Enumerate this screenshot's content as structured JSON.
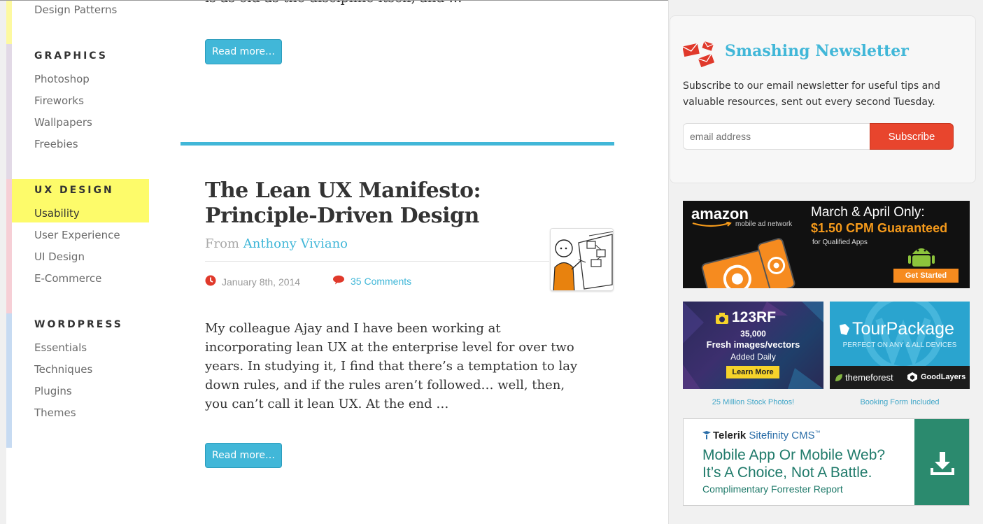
{
  "nav": {
    "top_item": "Design Patterns",
    "sections": [
      {
        "heading": "GRAPHICS",
        "items": [
          "Photoshop",
          "Fireworks",
          "Wallpapers",
          "Freebies"
        ]
      },
      {
        "heading": "UX DESIGN",
        "items": [
          "Usability",
          "User Experience",
          "UI Design",
          "E-Commerce"
        ]
      },
      {
        "heading": "WORDPRESS",
        "items": [
          "Essentials",
          "Techniques",
          "Plugins",
          "Themes"
        ]
      }
    ],
    "strip_colors": [
      "#fdf9a0",
      "#e2d9e6",
      "#f6cfd6",
      "#c7dbf2"
    ],
    "highlight_color": "#fdfb6a"
  },
  "prev_post": {
    "excerpt_tail": "is as old as the discipline itself, and …",
    "read_more": "Read more…"
  },
  "post": {
    "title_line1": "The Lean UX Manifesto:",
    "title_line2": "Principle-Driven Design",
    "from_label": "From",
    "author": "Anthony Viviano",
    "date": "January 8th, 2014",
    "comments": "35 Comments",
    "excerpt": "My colleague Ajay and I have been working at incorporating lean UX at the enterprise level for over two years. In studying it, I find that there’s a temptation to lay down rules, and if the rules aren’t followed… well, then, you can’t call it lean UX. At the end …",
    "read_more": "Read more…"
  },
  "newsletter": {
    "title": "Smashing Newsletter",
    "text": "Subscribe to our email newsletter for useful tips and valuable resources, sent out every second Tuesday.",
    "placeholder": "email address",
    "button": "Subscribe"
  },
  "ads": {
    "amazon": {
      "brand": "amazon",
      "sub": "mobile ad network",
      "headline": "March & April Only:",
      "price": "$1.50 CPM Guaranteed",
      "qualifier": "for Qualified Apps",
      "cta": "Get Started"
    },
    "rf": {
      "brand": "123RF",
      "count": "35,000",
      "line1": "Fresh images/vectors",
      "line2": "Added Daily",
      "cta": "Learn More",
      "caption": "25 Million Stock Photos!"
    },
    "tour": {
      "brand": "TourPackage",
      "sub": "PERFECT ON ANY & ALL DEVICES",
      "logo1": "themeforest",
      "logo2": "GoodLayers",
      "caption": "Booking Form Included"
    },
    "telerik": {
      "brand": "Telerik",
      "product": "Sitefinity CMS",
      "tm": "™",
      "line1": "Mobile App Or Mobile Web?",
      "line2": "It’s A Choice, Not A Battle.",
      "line3": "Complimentary Forrester Report"
    }
  },
  "colors": {
    "accent": "#41b7d8",
    "subscribe": "#e8452d",
    "date_icon": "#e0392b",
    "telerik_green": "#2b8a6e"
  }
}
